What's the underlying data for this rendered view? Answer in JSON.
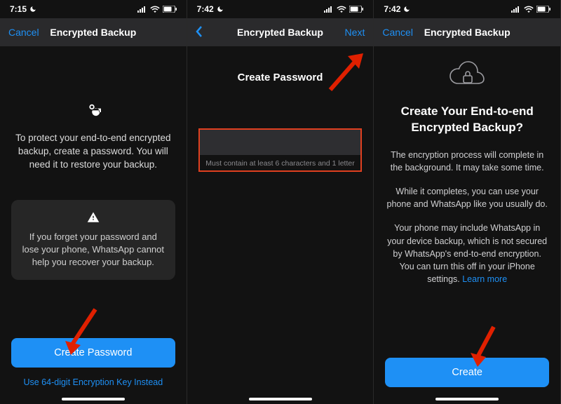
{
  "screen1": {
    "status": {
      "time": "7:15"
    },
    "nav": {
      "left_label": "Cancel",
      "title": "Encrypted Backup"
    },
    "body": "To protect your end-to-end encrypted backup, create a password. You will need it to restore your backup.",
    "warning": "If you forget your password and lose your phone, WhatsApp cannot help you recover your backup.",
    "cta_label": "Create Password",
    "alt_link": "Use 64-digit Encryption Key Instead"
  },
  "screen2": {
    "status": {
      "time": "7:42"
    },
    "nav": {
      "title": "Encrypted Backup",
      "right_label": "Next"
    },
    "heading": "Create Password",
    "helper": "Must contain at least 6 characters and 1 letter"
  },
  "screen3": {
    "status": {
      "time": "7:42"
    },
    "nav": {
      "left_label": "Cancel",
      "title": "Encrypted Backup"
    },
    "heading": "Create Your End-to-end Encrypted Backup?",
    "para1": "The encryption process will complete in the background. It may take some time.",
    "para2": "While it completes, you can use your phone and WhatsApp like you usually do.",
    "para3": "Your phone may include WhatsApp in your device backup, which is not secured by WhatsApp's end-to-end encryption. You can turn this off in your iPhone settings.",
    "learn_more": "Learn more",
    "cta_label": "Create"
  }
}
